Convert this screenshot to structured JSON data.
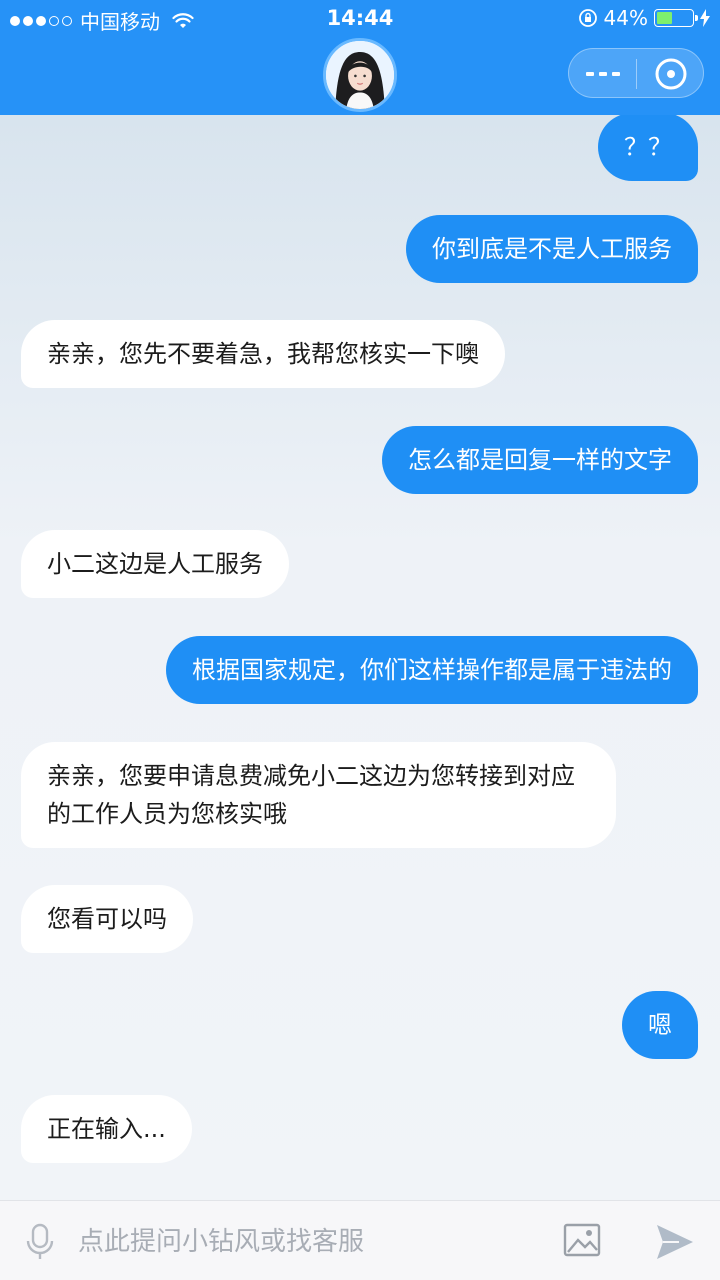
{
  "status": {
    "carrier": "中国移动",
    "time": "14:44",
    "battery_pct": "44%",
    "battery_level": 0.44
  },
  "header": {
    "avatar_icon": "agent-avatar",
    "more_icon": "more-icon",
    "close_icon": "close-icon"
  },
  "messages": [
    {
      "side": "out",
      "text": "？？"
    },
    {
      "side": "out",
      "text": "你到底是不是人工服务"
    },
    {
      "side": "in",
      "text": "亲亲，您先不要着急，我帮您核实一下噢"
    },
    {
      "side": "out",
      "text": "怎么都是回复一样的文字"
    },
    {
      "side": "in",
      "text": "小二这边是人工服务"
    },
    {
      "side": "out",
      "text": "根据国家规定，你们这样操作都是属于违法的"
    },
    {
      "side": "in",
      "text": "亲亲，您要申请息费减免小二这边为您转接到对应的工作人员为您核实哦"
    },
    {
      "side": "in",
      "text": "您看可以吗"
    },
    {
      "side": "out",
      "text": "嗯"
    },
    {
      "side": "in",
      "text": "正在输入..."
    }
  ],
  "input": {
    "placeholder": "点此提问小钻风或找客服",
    "value": ""
  },
  "colors": {
    "header_bg": "#2692f7",
    "bubble_out": "#1f8ff5",
    "bubble_in": "#ffffff",
    "battery_fill": "#7ef06d"
  }
}
